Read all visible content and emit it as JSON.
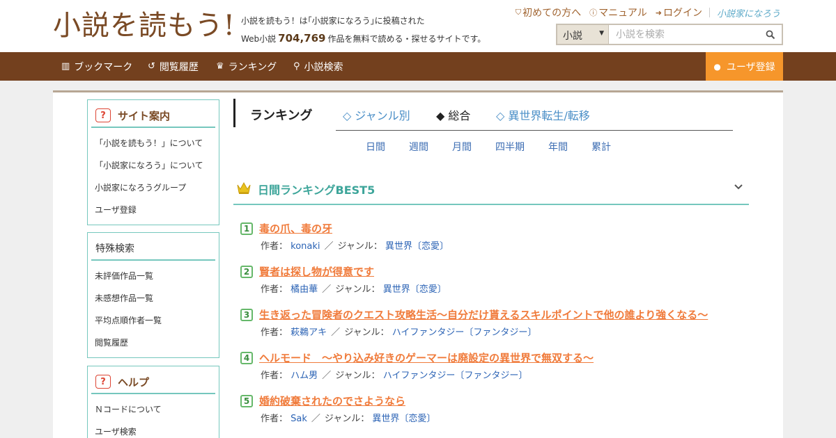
{
  "header": {
    "logo": "小説を読もう!",
    "tagline_line1": "小説を読もう！は｢小説家になろう｣に投稿された",
    "tagline_pre": "Web小説",
    "novel_count": "704,769",
    "tagline_post": "作品を無料で読める・探せるサイトです。",
    "links": {
      "first_time": "初めての方へ",
      "manual": "マニュアル",
      "login": "ログイン",
      "narou": "小説家になろう"
    },
    "search": {
      "select_value": "小説",
      "placeholder": "小説を検索"
    }
  },
  "nav": {
    "items": [
      "ブックマーク",
      "閲覧履歴",
      "ランキング",
      "小説検索"
    ],
    "register": "ユーザ登録"
  },
  "sidebar": {
    "site_guide": {
      "title": "サイト案内",
      "items": [
        "「小説を読もう！」について",
        "「小説家になろう」について",
        "小説家になろうグループ",
        "ユーザ登録"
      ]
    },
    "special": {
      "title": "特殊検索",
      "items": [
        "未評価作品一覧",
        "未感想作品一覧",
        "平均点順作者一覧",
        "閲覧履歴"
      ]
    },
    "help": {
      "title": "ヘルプ",
      "items": [
        "Ｎコードについて",
        "ユーザ検索"
      ]
    }
  },
  "ranking": {
    "title": "ランキング",
    "genre_tabs": [
      "◇ ジャンル別",
      "◆ 総合",
      "◇ 異世界転生/転移"
    ],
    "periods": [
      "日間",
      "週間",
      "月間",
      "四半期",
      "年間",
      "累計"
    ],
    "best_title": "日間ランキングBEST5",
    "author_label": "作者：",
    "genre_label": "ジャンル：",
    "separator": "／",
    "entries": [
      {
        "rank": "1",
        "title": "毒の爪、毒の牙",
        "author": "konaki",
        "genre": "異世界〔恋愛〕"
      },
      {
        "rank": "2",
        "title": "賢者は探し物が得意です",
        "author": "橘由華",
        "genre": "異世界〔恋愛〕"
      },
      {
        "rank": "3",
        "title": "生き返った冒険者のクエスト攻略生活～自分だけ貰えるスキルポイントで他の誰より強くなる～",
        "author": "萩鵜アキ",
        "genre": "ハイファンタジー〔ファンタジー〕"
      },
      {
        "rank": "4",
        "title": "ヘルモード　～やり込み好きのゲーマーは廃設定の異世界で無双する～",
        "author": "ハム男",
        "genre": "ハイファンタジー〔ファンタジー〕"
      },
      {
        "rank": "5",
        "title": "婚約破棄されたのでさようなら",
        "author": "Sak",
        "genre": "異世界〔恋愛〕"
      }
    ]
  }
}
